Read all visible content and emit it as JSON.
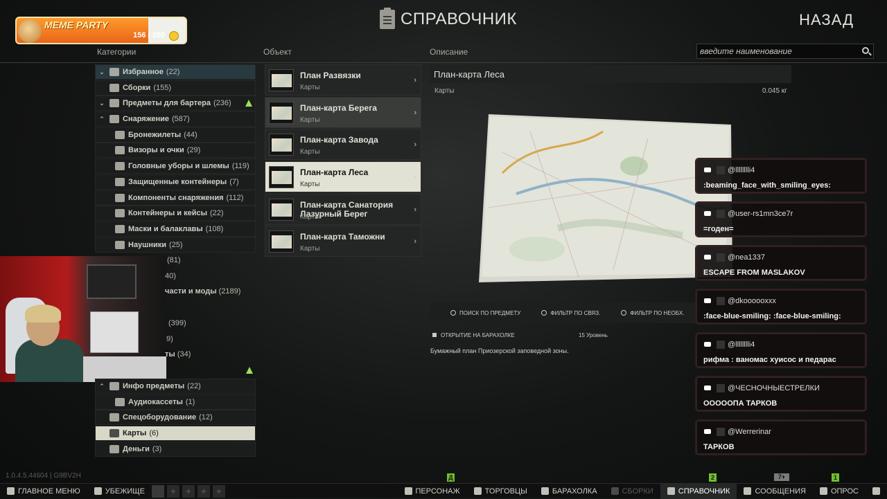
{
  "header": {
    "title": "СПРАВОЧНИК",
    "back_label": "НАЗАД"
  },
  "stream_badge": {
    "name": "MEME PARTY",
    "progress_text": "156 / 200",
    "progress_fraction": 0.78
  },
  "columns": {
    "categories": "Категории",
    "object": "Объект",
    "description": "Описание"
  },
  "search": {
    "placeholder": "введите наименование"
  },
  "categories": [
    {
      "label": "Избранное",
      "count": "(22)",
      "chev": "⌄",
      "type": "fav"
    },
    {
      "label": "Сборки",
      "count": "(155)",
      "chev": "",
      "type": "plain"
    },
    {
      "label": "Предметы для бартера",
      "count": "(236)",
      "chev": "⌄",
      "type": "plain",
      "warn": true
    },
    {
      "label": "Снаряжение",
      "count": "(587)",
      "chev": "⌃",
      "type": "plain"
    },
    {
      "label": "Бронежилеты",
      "count": "(44)",
      "type": "sub"
    },
    {
      "label": "Визоры и очки",
      "count": "(29)",
      "type": "sub"
    },
    {
      "label": "Головные уборы и шлемы",
      "count": "(119)",
      "type": "sub"
    },
    {
      "label": "Защищенные контейнеры",
      "count": "(7)",
      "type": "sub"
    },
    {
      "label": "Компоненты снаряжения",
      "count": "(112)",
      "type": "sub"
    },
    {
      "label": "Контейнеры и кейсы",
      "count": "(22)",
      "type": "sub"
    },
    {
      "label": "Маски и балаклавы",
      "count": "(108)",
      "type": "sub"
    },
    {
      "label": "Наушники",
      "count": "(25)",
      "type": "sub"
    }
  ],
  "categories_hidden": [
    {
      "count": "(81)"
    },
    {
      "count": "40)"
    },
    {
      "label": "части и моды",
      "count": "(2189)"
    },
    {
      "label": "",
      "count": ""
    },
    {
      "count": "(399)"
    },
    {
      "count": "9)"
    },
    {
      "label": "ты",
      "count": "(34)"
    }
  ],
  "categories_lower": [
    {
      "label": "Инфо предметы",
      "count": "(22)",
      "chev": "⌃",
      "type": "plain"
    },
    {
      "label": "Аудиокассеты",
      "count": "(1)",
      "type": "sub"
    },
    {
      "label": "Спецоборудование",
      "count": "(12)",
      "type": "plain"
    },
    {
      "label": "Карты",
      "count": "(6)",
      "type": "selected"
    },
    {
      "label": "Деньги",
      "count": "(3)",
      "type": "plain"
    }
  ],
  "objects": [
    {
      "name": "План Развязки",
      "type": "Карты",
      "state": ""
    },
    {
      "name": "План-карта Берега",
      "type": "Карты",
      "state": "hl"
    },
    {
      "name": "План-карта Завода",
      "type": "Карты",
      "state": ""
    },
    {
      "name": "План-карта Леса",
      "type": "Карты",
      "state": "active"
    },
    {
      "name": "План-карта Санатория Лазурный Берег",
      "type": "Карты",
      "state": ""
    },
    {
      "name": "План-карта Таможни",
      "type": "Карты",
      "state": ""
    }
  ],
  "description": {
    "title": "План-карта Леса",
    "type": "Карты",
    "weight": "0.045 кг",
    "actions": [
      "ПОИСК ПО ПРЕДМЕТУ",
      "ФИЛЬТР ПО СВЯЗ.",
      "ФИЛЬТР ПО НЕОБХ."
    ],
    "market_label": "ОТКРЫТИЕ НА БАРАХОЛКЕ",
    "market_level": "15 Уровень",
    "text": "Бумажный план Приозерской заповедной зоны."
  },
  "chat": [
    {
      "user": "@lllllllli4",
      "message": ":beaming_face_with_smiling_eyes:"
    },
    {
      "user": "@user-rs1mn3ce7r",
      "message": "=годен="
    },
    {
      "user": "@nea1337",
      "message": "ESCAPE FROM MASLAKOV"
    },
    {
      "user": "@dkoooooxxx",
      "message": ":face-blue-smiling: :face-blue-smiling:"
    },
    {
      "user": "@lllllllli4",
      "message": "рифма : ваномас хуисос и педарас"
    },
    {
      "user": "@ЧЕСНОЧНЫЕСТРЕЛКИ",
      "message": "ОООООПА ТАРКОВ"
    },
    {
      "user": "@Werrerinar",
      "message": "ТАРКОВ"
    }
  ],
  "version": "1.0.4.5.44604 | G9BV2H",
  "bottom_bar": {
    "main_menu": "ГЛАВНОЕ МЕНЮ",
    "hideout": "УБЕЖИЩЕ",
    "character": "ПЕРСОНАЖ",
    "traders": "ТОРГОВЦЫ",
    "flea": "БАРАХОЛКА",
    "builds": "СБОРКИ",
    "handbook": "СПРАВОЧНИК",
    "messages": "СООБЩЕНИЯ",
    "survey": "ОПРОС",
    "notif_character": "Д",
    "notif_messages": "2",
    "notif_messages_grey": "7+",
    "notif_survey": "1"
  },
  "colors": {
    "accent_green": "#6fbf2e",
    "selected_bg": "#e2e2d4",
    "badge_orange": "#e8651b"
  }
}
